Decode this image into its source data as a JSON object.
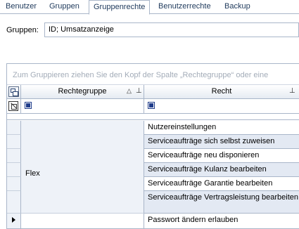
{
  "tabs": [
    {
      "label": "Benutzer",
      "active": false
    },
    {
      "label": "Gruppen",
      "active": false
    },
    {
      "label": "Gruppenrechte",
      "active": true
    },
    {
      "label": "Benutzerrechte",
      "active": false
    },
    {
      "label": "Backup",
      "active": false
    }
  ],
  "groups": {
    "label": "Gruppen:",
    "value": "ID; Umsatzanzeige"
  },
  "grid": {
    "group_hint": "Zum Gruppieren ziehen Sie den Kopf der Spalte „Rechtegruppe“ oder eine",
    "columns": {
      "group": "Rechtegruppe",
      "right": "Recht"
    },
    "group_value": "Flex",
    "rows": [
      "Nutzereinstellungen",
      "Serviceaufträge sich selbst zuweisen",
      "Serviceaufträge neu disponieren",
      "Serviceaufträge Kulanz bearbeiten",
      "Serviceaufträge Garantie bearbeiten",
      "Serviceaufträge Vertragsleistung bearbeiten",
      "Passwort ändern erlauben"
    ]
  }
}
